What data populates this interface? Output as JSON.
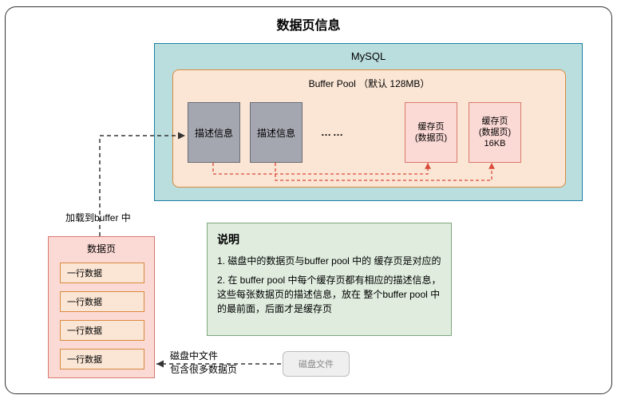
{
  "title": "数据页信息",
  "mysql": {
    "label": "MySQL"
  },
  "bufferPool": {
    "label": "Buffer Pool （默认 128MB）",
    "desc1": "描述信息",
    "desc2": "描述信息",
    "dots": "……",
    "cache1": "缓存页\n(数据页)",
    "cache2": "缓存页\n(数据页)\n16KB"
  },
  "loadLabel": "加载到buffer 中",
  "dataPage": {
    "label": "数据页",
    "rows": [
      "一行数据",
      "一行数据",
      "一行数据",
      "一行数据"
    ]
  },
  "explain": {
    "title": "说明",
    "line1": "1. 磁盘中的数据页与buffer pool 中的 缓存页是对应的",
    "line2": "2. 在 buffer pool 中每个缓存页都有相应的描述信息，这些每张数据页的描述信息，放在 整个buffer pool 中的最前面，后面才是缓存页"
  },
  "diskFile": {
    "label": "磁盘文件"
  },
  "diskLabel": "磁盘中文件\n包含很多数据页"
}
